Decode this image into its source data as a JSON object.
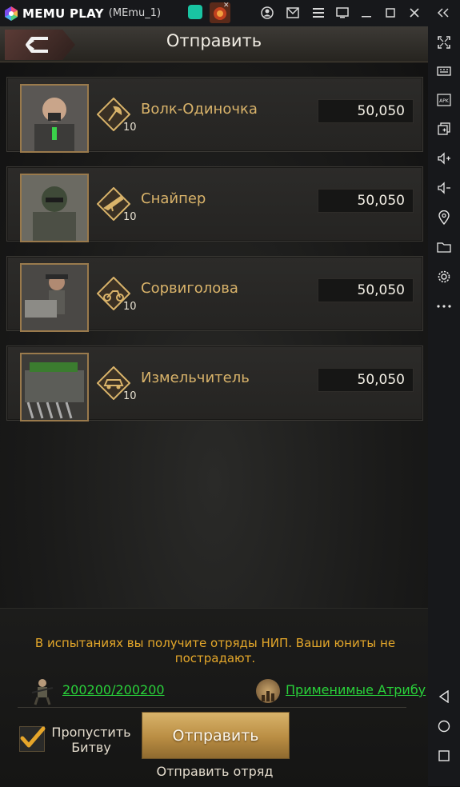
{
  "window": {
    "brand": "MEMU PLAY",
    "instance": "(MEmu_1)"
  },
  "game": {
    "title": "Отправить",
    "units": [
      {
        "name": "Волк-Одиночка",
        "level": "10",
        "count": "50,050",
        "badge": "axe-icon"
      },
      {
        "name": "Снайпер",
        "level": "10",
        "count": "50,050",
        "badge": "rifle-icon"
      },
      {
        "name": "Сорвиголова",
        "level": "10",
        "count": "50,050",
        "badge": "motorcycle-icon"
      },
      {
        "name": "Измельчитель",
        "level": "10",
        "count": "50,050",
        "badge": "car-icon"
      }
    ],
    "info": "В испытаниях вы получите отряды НИП. Ваши юниты не пострадают.",
    "troops": "200200/200200",
    "attributes_link": "Применимые Атрибу",
    "skip_label": "Пропустить Битву",
    "skip_checked": true,
    "send_button": "Отправить",
    "send_sub": "Отправить отряд"
  },
  "colors": {
    "gold": "#d9b36a",
    "info": "#e4a72a",
    "link": "#29d13a"
  }
}
